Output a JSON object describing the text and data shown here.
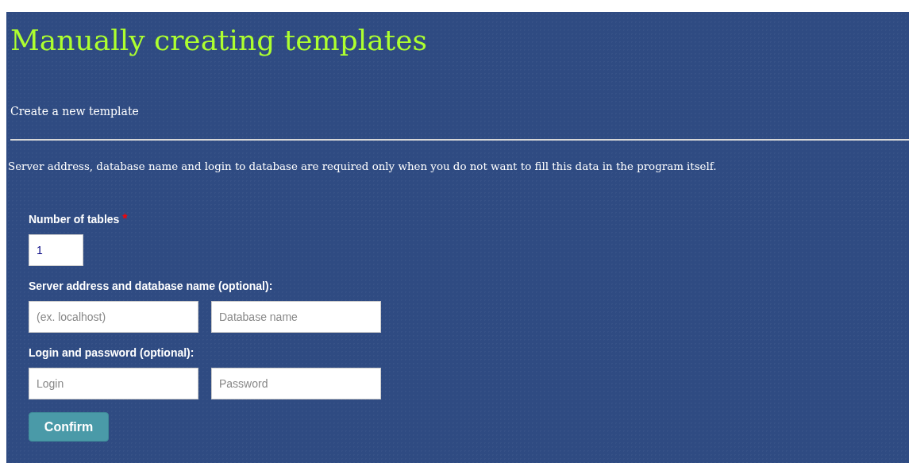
{
  "page": {
    "title": "Manually creating templates",
    "subtitle": "Create a new template",
    "description": "Server address, database name and login to database are required only when you do not want to fill this data in the program itself."
  },
  "form": {
    "groups": [
      {
        "label": "Number of tables",
        "required_mark": "*",
        "fields": [
          {
            "kind": "small",
            "value": "1"
          }
        ]
      },
      {
        "label": "Server address and database name (optional):",
        "fields": [
          {
            "kind": "wide",
            "placeholder": "(ex. localhost)"
          },
          {
            "kind": "wide",
            "placeholder": "Database name"
          }
        ]
      },
      {
        "label": "Login and password (optional):",
        "fields": [
          {
            "kind": "wide",
            "placeholder": "Login"
          },
          {
            "kind": "wide",
            "placeholder": "Password"
          }
        ]
      }
    ],
    "submit": "Confirm"
  }
}
